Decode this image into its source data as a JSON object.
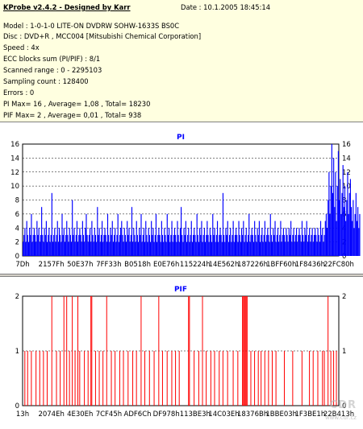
{
  "info": {
    "title": "KProbe v2.4.2 - Designed by Karr",
    "date": "Date : 10.1.2005 18:45:14",
    "lines": [
      "Model : 1-0-1-0 LITE-ON DVDRW SOHW-1633S BS0C",
      "Disc : DVD+R , MCC004 [Mitsubishi Chemical Corporation]",
      "Speed : 4x",
      "ECC blocks sum (PI/PIF) : 8/1",
      "Scanned range : 0 - 2295103",
      "Sampling count : 128400",
      "Errors : 0",
      "PI Max= 16 , Average= 1,08 , Total= 18230",
      "PIF Max= 2 , Average= 0,01 , Total= 938"
    ]
  },
  "watermark": {
    "text": "CDR",
    "sub": "www.cdr.cz"
  },
  "colors": {
    "pi": "#0000ff",
    "pif": "#ff0000",
    "background": "#ffffe0",
    "title": "#0000ff"
  },
  "chart_data": [
    {
      "type": "bar",
      "title": "PI",
      "ylim": [
        0,
        16
      ],
      "y_ticks": [
        0,
        2,
        4,
        6,
        8,
        10,
        12,
        14,
        16
      ],
      "x_tick_labels": [
        "7Dh",
        "2157Fh",
        "50E37h",
        "7FF33h",
        "B0518h",
        "E0E76h",
        "115224h",
        "14E562h",
        "187226h",
        "1BFF60h",
        "1F8436h",
        "22FC80h"
      ],
      "grid": "dashed",
      "color": "#0000ff",
      "num_samples": 340,
      "values": [
        2,
        3,
        4,
        2,
        5,
        3,
        2,
        4,
        3,
        6,
        2,
        3,
        4,
        3,
        2,
        5,
        3,
        4,
        2,
        3,
        7,
        3,
        2,
        4,
        3,
        5,
        2,
        3,
        4,
        2,
        3,
        9,
        2,
        3,
        4,
        2,
        3,
        5,
        2,
        4,
        3,
        2,
        6,
        3,
        4,
        2,
        3,
        5,
        3,
        2,
        4,
        3,
        2,
        8,
        3,
        4,
        2,
        3,
        5,
        2,
        3,
        4,
        3,
        2,
        5,
        3,
        2,
        4,
        6,
        3,
        2,
        3,
        4,
        2,
        5,
        3,
        2,
        4,
        3,
        2,
        7,
        3,
        4,
        2,
        3,
        5,
        2,
        3,
        4,
        3,
        2,
        6,
        3,
        2,
        4,
        3,
        5,
        2,
        3,
        4,
        2,
        3,
        6,
        2,
        3,
        4,
        5,
        3,
        2,
        4,
        3,
        2,
        5,
        3,
        4,
        2,
        3,
        7,
        2,
        4,
        3,
        2,
        5,
        3,
        2,
        4,
        3,
        6,
        2,
        3,
        4,
        2,
        5,
        3,
        2,
        4,
        3,
        2,
        5,
        3,
        4,
        2,
        3,
        6,
        2,
        3,
        4,
        3,
        2,
        5,
        3,
        2,
        4,
        3,
        2,
        6,
        3,
        4,
        2,
        3,
        5,
        2,
        3,
        4,
        3,
        2,
        5,
        3,
        2,
        4,
        7,
        3,
        2,
        4,
        3,
        5,
        2,
        3,
        4,
        2,
        3,
        5,
        2,
        3,
        4,
        3,
        2,
        6,
        3,
        2,
        4,
        3,
        5,
        2,
        3,
        4,
        2,
        3,
        5,
        3,
        2,
        4,
        3,
        2,
        6,
        3,
        4,
        2,
        3,
        5,
        2,
        3,
        4,
        3,
        2,
        9,
        3,
        2,
        4,
        3,
        5,
        2,
        3,
        4,
        2,
        3,
        5,
        2,
        3,
        4,
        3,
        2,
        5,
        3,
        2,
        4,
        3,
        5,
        2,
        3,
        4,
        2,
        3,
        6,
        2,
        3,
        4,
        3,
        2,
        5,
        3,
        2,
        4,
        3,
        5,
        2,
        3,
        4,
        2,
        3,
        5,
        2,
        3,
        4,
        3,
        2,
        6,
        3,
        2,
        4,
        3,
        5,
        2,
        3,
        4,
        2,
        3,
        5,
        2,
        3,
        4,
        3,
        2,
        4,
        3,
        2,
        4,
        3,
        5,
        2,
        3,
        4,
        2,
        3,
        4,
        2,
        3,
        4,
        3,
        2,
        5,
        3,
        2,
        4,
        3,
        5,
        2,
        3,
        4,
        2,
        3,
        4,
        2,
        3,
        4,
        3,
        2,
        4,
        3,
        2,
        5,
        3,
        4,
        2,
        3,
        5,
        6,
        4,
        8,
        12,
        6,
        10,
        16,
        9,
        14,
        7,
        12,
        5,
        10,
        15,
        8,
        11,
        6,
        9,
        13,
        7,
        10,
        5,
        8,
        12,
        6,
        9,
        11,
        7,
        5,
        8,
        4,
        6,
        9,
        5,
        7,
        4,
        6
      ]
    },
    {
      "type": "bar",
      "title": "PIF",
      "ylim": [
        0,
        2
      ],
      "y_ticks": [
        0,
        1,
        2
      ],
      "x_tick_labels": [
        "13h",
        "2074Eh",
        "4E30Eh",
        "7CF45h",
        "ADF6Ch",
        "DF978h",
        "113BE3h",
        "14C03Eh",
        "18376Bh",
        "1BBE03h",
        "1F3BE1h",
        "22B413h"
      ],
      "grid": "dashed",
      "color": "#ff0000",
      "num_samples": 340,
      "spikes": [
        {
          "i": 2,
          "v": 1
        },
        {
          "i": 5,
          "v": 1
        },
        {
          "i": 9,
          "v": 1
        },
        {
          "i": 14,
          "v": 1
        },
        {
          "i": 18,
          "v": 1
        },
        {
          "i": 22,
          "v": 1
        },
        {
          "i": 26,
          "v": 1
        },
        {
          "i": 31,
          "v": 2
        },
        {
          "i": 36,
          "v": 1
        },
        {
          "i": 40,
          "v": 1
        },
        {
          "i": 44,
          "v": 2
        },
        {
          "i": 47,
          "v": 2
        },
        {
          "i": 50,
          "v": 1
        },
        {
          "i": 53,
          "v": 2
        },
        {
          "i": 56,
          "v": 1
        },
        {
          "i": 59,
          "v": 2
        },
        {
          "i": 61,
          "v": 1
        },
        {
          "i": 66,
          "v": 1
        },
        {
          "i": 70,
          "v": 1
        },
        {
          "i": 73,
          "v": 2
        },
        {
          "i": 74,
          "v": 2
        },
        {
          "i": 78,
          "v": 1
        },
        {
          "i": 82,
          "v": 1
        },
        {
          "i": 86,
          "v": 1
        },
        {
          "i": 90,
          "v": 2
        },
        {
          "i": 95,
          "v": 1
        },
        {
          "i": 99,
          "v": 1
        },
        {
          "i": 104,
          "v": 1
        },
        {
          "i": 108,
          "v": 1
        },
        {
          "i": 113,
          "v": 1
        },
        {
          "i": 118,
          "v": 1
        },
        {
          "i": 122,
          "v": 1
        },
        {
          "i": 127,
          "v": 2
        },
        {
          "i": 131,
          "v": 1
        },
        {
          "i": 136,
          "v": 1
        },
        {
          "i": 141,
          "v": 1
        },
        {
          "i": 146,
          "v": 2
        },
        {
          "i": 150,
          "v": 1
        },
        {
          "i": 155,
          "v": 1
        },
        {
          "i": 160,
          "v": 1
        },
        {
          "i": 164,
          "v": 1
        },
        {
          "i": 168,
          "v": 1
        },
        {
          "i": 178,
          "v": 2
        },
        {
          "i": 179,
          "v": 2
        },
        {
          "i": 184,
          "v": 1
        },
        {
          "i": 189,
          "v": 1
        },
        {
          "i": 193,
          "v": 2
        },
        {
          "i": 197,
          "v": 1
        },
        {
          "i": 202,
          "v": 1
        },
        {
          "i": 206,
          "v": 1
        },
        {
          "i": 211,
          "v": 1
        },
        {
          "i": 215,
          "v": 1
        },
        {
          "i": 220,
          "v": 1
        },
        {
          "i": 226,
          "v": 1
        },
        {
          "i": 231,
          "v": 1
        },
        {
          "i": 236,
          "v": 2
        },
        {
          "i": 237,
          "v": 2
        },
        {
          "i": 238,
          "v": 2
        },
        {
          "i": 239,
          "v": 2
        },
        {
          "i": 240,
          "v": 2
        },
        {
          "i": 241,
          "v": 2
        },
        {
          "i": 245,
          "v": 1
        },
        {
          "i": 249,
          "v": 1
        },
        {
          "i": 253,
          "v": 1
        },
        {
          "i": 256,
          "v": 1
        },
        {
          "i": 260,
          "v": 1
        },
        {
          "i": 264,
          "v": 1
        },
        {
          "i": 268,
          "v": 1
        },
        {
          "i": 272,
          "v": 1
        },
        {
          "i": 281,
          "v": 1
        },
        {
          "i": 290,
          "v": 1
        },
        {
          "i": 300,
          "v": 1
        },
        {
          "i": 308,
          "v": 1
        },
        {
          "i": 312,
          "v": 1
        },
        {
          "i": 317,
          "v": 1
        },
        {
          "i": 322,
          "v": 1
        },
        {
          "i": 324,
          "v": 1
        },
        {
          "i": 328,
          "v": 2
        },
        {
          "i": 331,
          "v": 1
        },
        {
          "i": 334,
          "v": 1
        },
        {
          "i": 337,
          "v": 1
        }
      ]
    }
  ]
}
